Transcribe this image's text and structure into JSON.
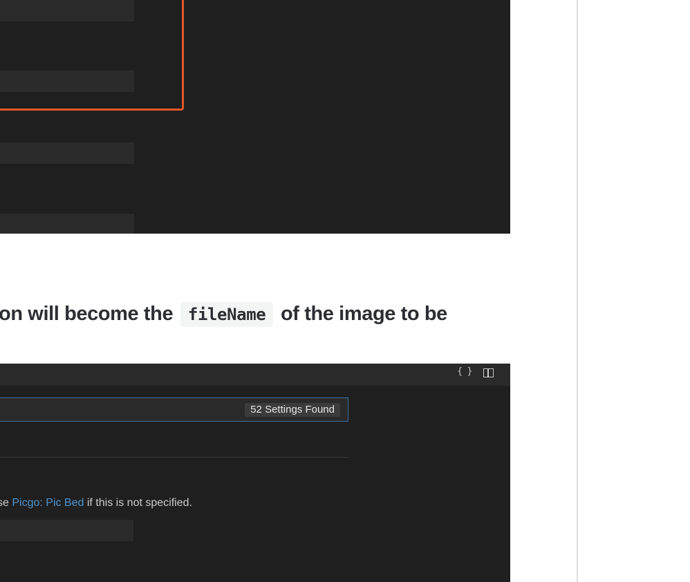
{
  "article": {
    "paragraph_before": "on will become the",
    "code": "fileName",
    "paragraph_after": "of the image to be"
  },
  "settings_window": {
    "format_icon": "{ }",
    "split_icon": "split-editor-icon",
    "search": {
      "value": "",
      "result_count": "52 Settings Found"
    },
    "setting": {
      "desc_before": "se",
      "link_text": "Picgo: Pic Bed",
      "desc_after": "if this is not specified.",
      "value": ""
    }
  },
  "colors": {
    "highlight_border": "#e8582a",
    "editor_bg": "#1f1f1f",
    "link": "#4e94ce",
    "focus_border": "#3a6fa6"
  }
}
